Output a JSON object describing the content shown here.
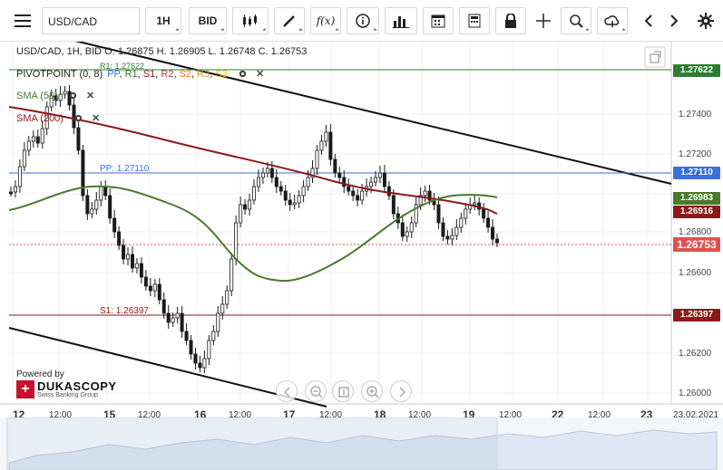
{
  "toolbar": {
    "symbol": "USD/CAD",
    "timeframe": "1H",
    "side": "BID"
  },
  "legend": {
    "header": "USD/CAD, 1H, BID  O. 1.26875 H. 1.26905 L. 1.26748 C. 1.26753",
    "pivot": "PIVOTPOINT (0, 8)",
    "pivot_lines": [
      {
        "label": "PP",
        "color": "#3a6fd8"
      },
      {
        "label": "R1",
        "color": "#2e7d32"
      },
      {
        "label": "S1",
        "color": "#8b1a1a"
      },
      {
        "label": "R2",
        "color": "#c0392b"
      },
      {
        "label": "S2",
        "color": "#e67e22"
      },
      {
        "label": "R3",
        "color": "#d4a017"
      },
      {
        "label": "S3",
        "color": "#f1c40f"
      }
    ],
    "sma50": "SMA (50)",
    "sma200": "SMA (200)"
  },
  "levels": {
    "r1_label": "R1: 1.27622",
    "pp_label": "PP: 1.27110",
    "s1_label": "S1: 1.26397"
  },
  "price_tags": {
    "r1": "1.27622",
    "pp": "1.27110",
    "sma50": "1.26983",
    "sma200": "1.26916",
    "last": "1.26753",
    "s1": "1.26397"
  },
  "colors": {
    "r1": "#2e7d32",
    "pp": "#3a6fd8",
    "s1": "#8b1a1a",
    "sma50": "#4a7a2c",
    "sma200": "#8b1a1a",
    "last": "#e05050",
    "candle": "#1a1a1a"
  },
  "yaxis": [
    "1.27400",
    "1.27200",
    "1.26800",
    "1.26600",
    "1.26200",
    "1.26000"
  ],
  "xaxis": [
    {
      "t": "12",
      "day": true
    },
    {
      "t": "12:00",
      "day": false
    },
    {
      "t": "15",
      "day": true
    },
    {
      "t": "12:00",
      "day": false
    },
    {
      "t": "16",
      "day": true
    },
    {
      "t": "12:00",
      "day": false
    },
    {
      "t": "17",
      "day": true
    },
    {
      "t": "12:00",
      "day": false
    },
    {
      "t": "18",
      "day": true
    },
    {
      "t": "12:00",
      "day": false
    },
    {
      "t": "19",
      "day": true
    },
    {
      "t": "12:00",
      "day": false
    },
    {
      "t": "22",
      "day": true
    },
    {
      "t": "12:00",
      "day": false
    },
    {
      "t": "23",
      "day": true
    },
    {
      "t": "23.02.2021",
      "day": false
    }
  ],
  "branding": {
    "powered": "Powered by",
    "name": "DUKASCOPY",
    "tagline": "Swiss Banking Group"
  }
}
